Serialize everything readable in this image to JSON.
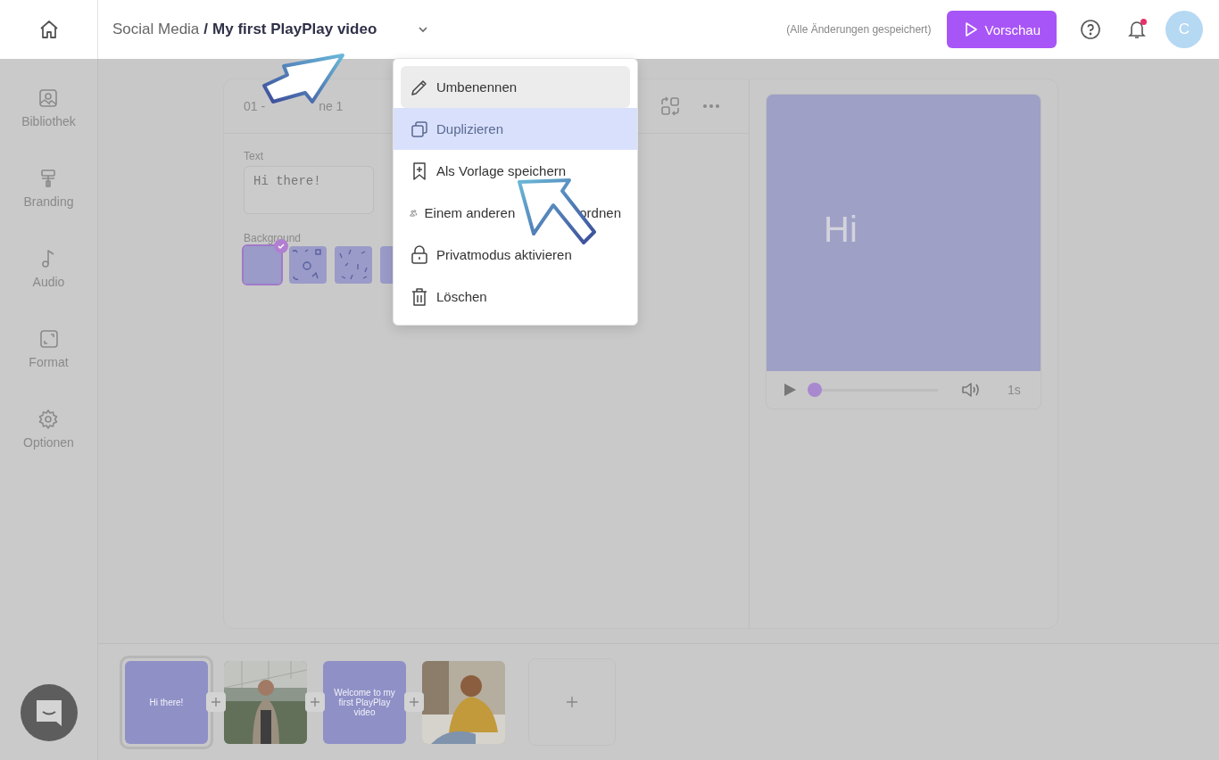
{
  "header": {
    "breadcrumb_folder": "Social Media",
    "breadcrumb_separator": "/",
    "video_title": "My first PlayPlay video",
    "save_status": "(Alle Änderungen gespeichert)",
    "preview_button": "Vorschau",
    "notification_unread": true,
    "avatar_initial": "C"
  },
  "sidebar": {
    "items": [
      {
        "label": "Bibliothek"
      },
      {
        "label": "Branding"
      },
      {
        "label": "Audio"
      },
      {
        "label": "Format"
      },
      {
        "label": "Optionen"
      }
    ]
  },
  "editor": {
    "scene_title_parts": [
      "01 -",
      "ne 1"
    ],
    "text_label": "Text",
    "text_value": "Hi there!",
    "background_label": "Background",
    "backgrounds": [
      {
        "kind": "plain",
        "selected": true
      },
      {
        "kind": "shapes",
        "selected": false
      },
      {
        "kind": "confetti",
        "selected": false
      },
      {
        "kind": "plain",
        "selected": false
      }
    ]
  },
  "preview": {
    "canvas_text": "Hi",
    "level": 0,
    "duration": "1s"
  },
  "menu": {
    "items": [
      {
        "parts": [
          "Umbenennen"
        ],
        "hovered": true,
        "selected": false
      },
      {
        "parts": [
          "Duplizieren"
        ],
        "hovered": false,
        "selected": true
      },
      {
        "parts": [
          "Als Vorlage speichern"
        ],
        "hovered": false,
        "selected": false
      },
      {
        "parts": [
          "Einem anderen",
          "ordnen"
        ],
        "hovered": false,
        "selected": false
      },
      {
        "parts": [
          "Privatmodus aktivieren"
        ],
        "hovered": false,
        "selected": false
      },
      {
        "parts": [
          "Löschen"
        ],
        "hovered": false,
        "selected": false
      }
    ]
  },
  "timeline": {
    "scenes": [
      {
        "kind": "text",
        "text": "Hi there!",
        "selected": true
      },
      {
        "kind": "picture",
        "selected": false
      },
      {
        "kind": "text",
        "text": "Welcome to my first PlayPlay video",
        "selected": false
      },
      {
        "kind": "picture",
        "selected": false
      }
    ]
  }
}
